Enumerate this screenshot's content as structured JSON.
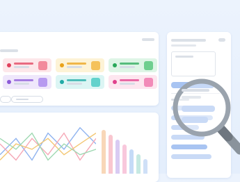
{
  "palette": {
    "background": "#e8f0fc",
    "panel": "#ffffff",
    "placeholder_line": "#d9dee6",
    "highlight_bar": "#a8c4f2",
    "magnifier_rim": "#9aa3ad",
    "magnifier_handle": "#8a939c"
  },
  "cards": [
    {
      "bg": "#fde7ea",
      "accent": "#e0405c",
      "square": "#f28a9c"
    },
    {
      "bg": "#fdf3d6",
      "accent": "#e9a21a",
      "square": "#f5c25b"
    },
    {
      "bg": "#def5e6",
      "accent": "#29a85a",
      "square": "#6fcf8f"
    },
    {
      "bg": "#efe7fb",
      "accent": "#8c5ad8",
      "square": "#b79af0"
    },
    {
      "bg": "#dcf5f4",
      "accent": "#20aaa6",
      "square": "#63d2cc"
    },
    {
      "bg": "#fde6ef",
      "accent": "#e0408c",
      "square": "#f28ab8"
    }
  ],
  "line_chart": {
    "series": [
      {
        "color": "#8fb3ef",
        "values": [
          3,
          6,
          2,
          7,
          4,
          8,
          5
        ]
      },
      {
        "color": "#f5a8b6",
        "values": [
          5,
          2,
          6,
          3,
          7,
          2,
          6
        ]
      },
      {
        "color": "#f3c774",
        "values": [
          2,
          5,
          4,
          6,
          3,
          5,
          7
        ]
      },
      {
        "color": "#9fd8b2",
        "values": [
          6,
          4,
          7,
          2,
          5,
          3,
          4
        ]
      }
    ]
  },
  "bar_chart": {
    "values": [
      9,
      8,
      7,
      6,
      5,
      4,
      3
    ],
    "colors": [
      "#f8d7b8",
      "#f9c6cf",
      "#d9cbf3",
      "#f8c8dc",
      "#c5dbf7",
      "#c6e9e2",
      "#cfe0f7"
    ]
  },
  "magnifier": {
    "icon": "magnifying-glass-icon"
  }
}
